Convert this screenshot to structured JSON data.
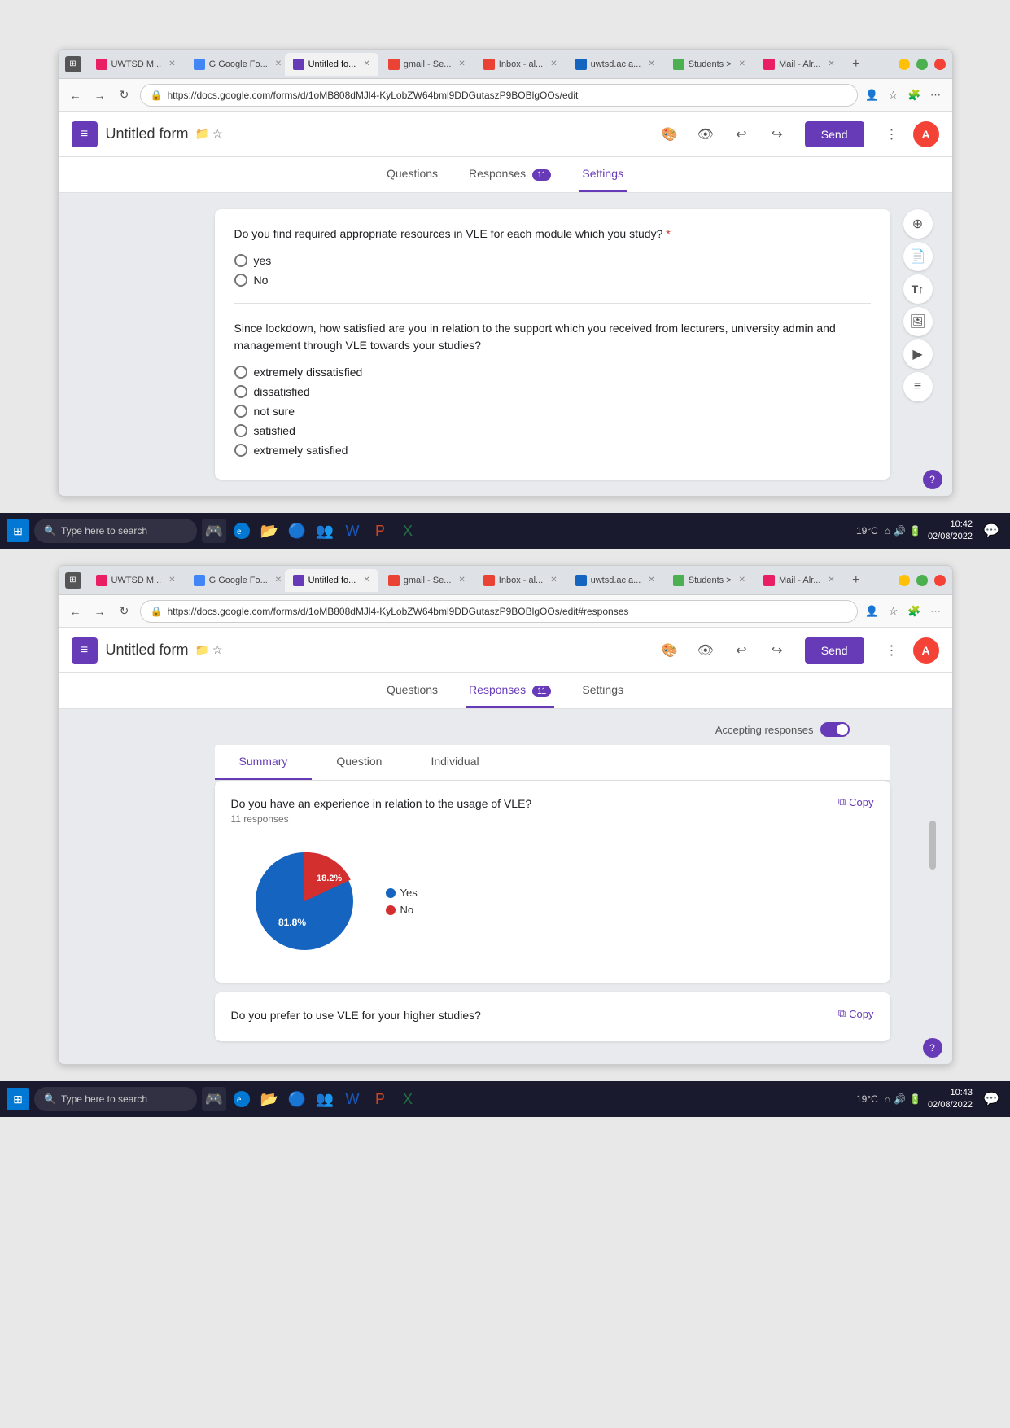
{
  "window1": {
    "tabs": [
      {
        "label": "UWTSD M...",
        "active": false,
        "favicon_color": "#e91e63"
      },
      {
        "label": "G Google Fo...",
        "active": false,
        "favicon_color": "#4285f4"
      },
      {
        "label": "Untitled fo...",
        "active": true,
        "favicon_color": "#673ab7"
      },
      {
        "label": "gmail - Se...",
        "active": false,
        "favicon_color": "#ea4335"
      },
      {
        "label": "Inbox - al...",
        "active": false,
        "favicon_color": "#ea4335"
      },
      {
        "label": "uwtsd.ac.a...",
        "active": false,
        "favicon_color": "#1565c0"
      },
      {
        "label": "Students >",
        "active": false,
        "favicon_color": "#4caf50"
      },
      {
        "label": "Mail - Alr...",
        "active": false,
        "favicon_color": "#e91e63"
      }
    ],
    "url": "https://docs.google.com/forms/d/1oMB808dMJl4-KyLobZW64bml9DDGutaszP9BOBlgOOs/edit",
    "app_title": "Untitled form",
    "send_label": "Send",
    "avatar_letter": "A",
    "tabs_nav": {
      "questions": "Questions",
      "responses": "Responses",
      "responses_count": "11",
      "settings": "Settings"
    },
    "question1": {
      "text": "Do you find required appropriate resources in VLE for each module which you study?",
      "required": true,
      "options": [
        "yes",
        "No"
      ]
    },
    "question2": {
      "text": "Since lockdown, how satisfied are you in relation to the support which you received from lecturers, university admin and management through VLE towards your studies?",
      "options": [
        "extremely dissatisfied",
        "dissatisfied",
        "not sure",
        "satisfied",
        "extremely satisfied"
      ]
    },
    "time": "10:42",
    "date": "02/08/2022",
    "taskbar_search": "Type here to search",
    "temperature": "19°C"
  },
  "window2": {
    "url": "https://docs.google.com/forms/d/1oMB808dMJl4-KyLobZW64bml9DDGutaszP9BOBlgOOs/edit#responses",
    "app_title": "Untitled form",
    "send_label": "Send",
    "avatar_letter": "A",
    "tabs_nav": {
      "questions": "Questions",
      "responses": "Responses",
      "responses_count": "11",
      "settings": "Settings"
    },
    "accepting_label": "Accepting responses",
    "resp_tabs": [
      "Summary",
      "Question",
      "Individual"
    ],
    "question1": {
      "text": "Do you have an experience in relation to the usage of VLE?",
      "count": "11 responses",
      "copy_label": "Copy",
      "chart": {
        "yes_percent": 81.8,
        "no_percent": 18.2,
        "yes_color": "#1565c0",
        "no_color": "#d32f2f",
        "yes_label": "81.8%",
        "no_label": "18.2%",
        "legend": [
          {
            "label": "Yes",
            "color": "#1565c0"
          },
          {
            "label": "No",
            "color": "#d32f2f"
          }
        ]
      }
    },
    "question2": {
      "text": "Do you prefer to use VLE for your higher studies?",
      "copy_label": "Copy"
    },
    "time": "10:43",
    "date": "02/08/2022",
    "taskbar_search": "Type here to search",
    "temperature": "19°C",
    "summary_label": "Summary"
  }
}
